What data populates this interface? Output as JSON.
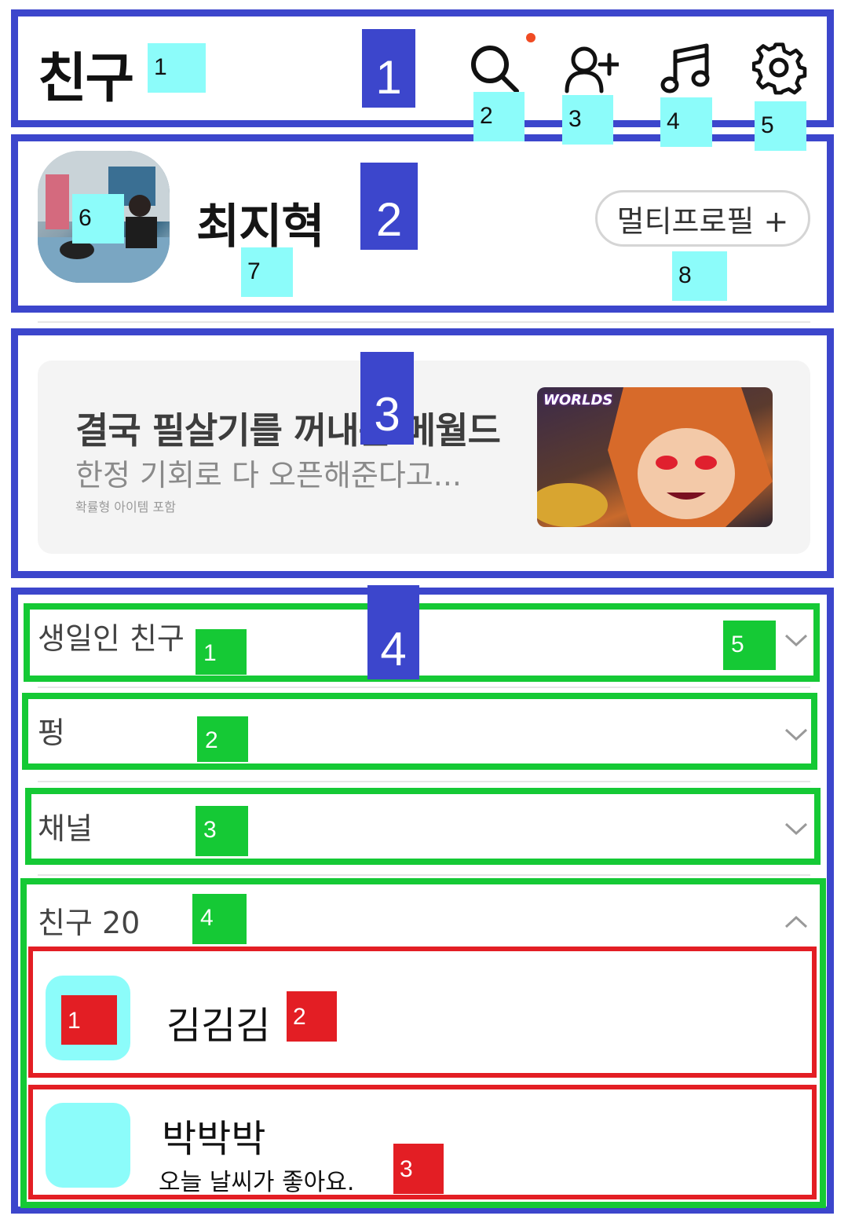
{
  "header": {
    "title": "친구",
    "notification_dot_color": "#f04b23",
    "icons": [
      "search-icon",
      "add-friend-icon",
      "music-icon",
      "settings-icon"
    ]
  },
  "profile": {
    "name": "최지혁",
    "multi_profile_label": "멀티프로필 +"
  },
  "ad": {
    "title": "결국 필살기를 꺼내든 메월드",
    "subtitle": "한정 기회로 다 오픈해준다고...",
    "note": "확률형 아이템 포함",
    "image_logo": "WORLDS"
  },
  "sections": [
    {
      "title": "생일인 친구",
      "expanded": false
    },
    {
      "title": "펑",
      "expanded": false
    },
    {
      "title": "채널",
      "expanded": false
    },
    {
      "title": "친구 20",
      "expanded": true
    }
  ],
  "friends": [
    {
      "name": "김김김",
      "status": ""
    },
    {
      "name": "박박박",
      "status": "오늘 날씨가 좋아요."
    }
  ],
  "annotations": {
    "blue": [
      "1",
      "2",
      "3",
      "4"
    ],
    "cyan": [
      "1",
      "2",
      "3",
      "4",
      "5",
      "6",
      "7",
      "8"
    ],
    "green": [
      "1",
      "2",
      "3",
      "4",
      "5"
    ],
    "red": [
      "1",
      "2",
      "3"
    ]
  },
  "colors": {
    "annotation_blue": "#3c46cc",
    "annotation_green": "#15c935",
    "annotation_red": "#e31e24",
    "annotation_cyan": "#8cfcfa"
  }
}
